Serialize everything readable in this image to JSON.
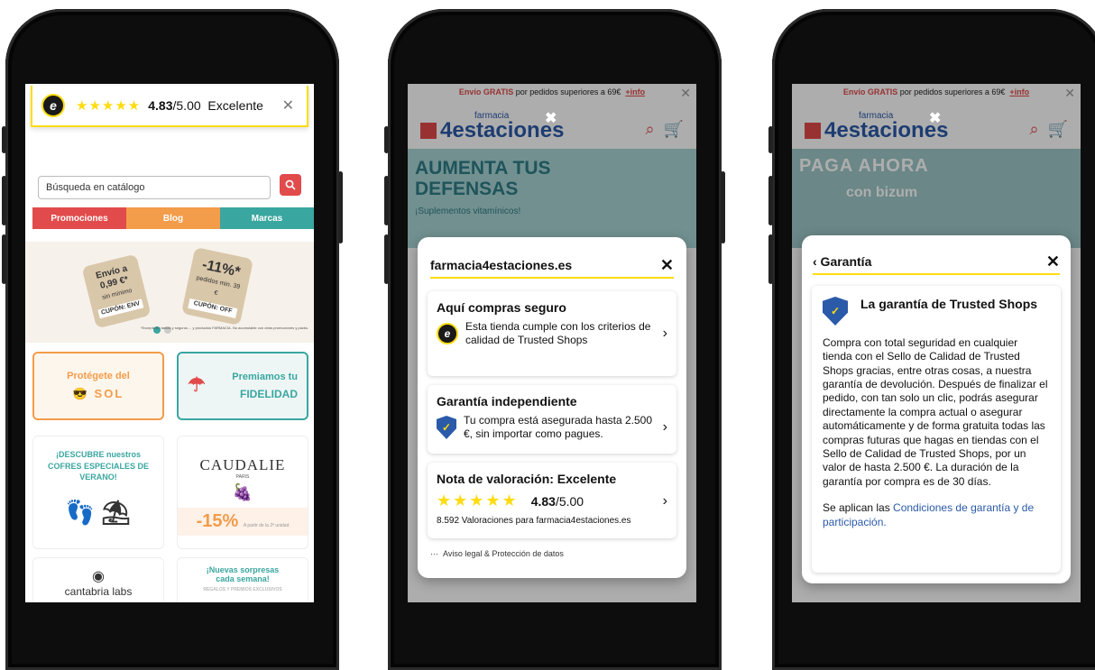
{
  "phone1": {
    "badge": {
      "stars": "★★★★★",
      "score": "4.83",
      "out_of": "/5.00",
      "label": "Excelente",
      "close": "✕",
      "logo": "e"
    },
    "search": {
      "placeholder": "Búsqueda en catálogo",
      "button_icon": "search-icon"
    },
    "tabs": [
      "Promociones",
      "Blog",
      "Marcas"
    ],
    "banner": {
      "tag1": "Envío a 0,99 €*",
      "tag1_sub": "sin mínimo",
      "tag1_coupon": "CUPÓN: ENV",
      "tag2": "-11%*",
      "tag2_sub": "pedidos min. 39 €",
      "tag2_coupon": "CUPÓN: OFF",
      "note": "*Excepto en tarifas y seguros ... y productos FARMACIA. No acumulable con otras promociones y packs."
    },
    "promo_sun": {
      "line1": "Protégete del",
      "line2": "SOL",
      "icon": "sun-glasses-icon"
    },
    "promo_loyal": {
      "line1": "Premiamos tu",
      "line2": "FIDELIDAD",
      "icon": "umbrella-icon"
    },
    "promo_box": {
      "text": "¡DESCUBRE nuestros COFRES ESPECIALES DE VERANO!"
    },
    "caudalie": {
      "brand": "CAUDALIE",
      "sub": "PARIS",
      "discount": "-15%",
      "discount_note": "A partir de la 2ª unidad"
    },
    "cantabria": {
      "brand": "cantabria labs"
    },
    "surprise": {
      "line1": "¡Nuevas sorpresas",
      "line2": "cada semana!",
      "line3": "REGALOS Y PREMIOS EXCLUSIVOS"
    }
  },
  "site": {
    "promo_bar": {
      "prefix": "Envío",
      "bold": "GRATIS",
      "text": "por pedidos superiores a 69€",
      "info": "+info",
      "close": "✕"
    },
    "logo": {
      "main": "4estaciones",
      "small": "farmacia"
    },
    "hero2": {
      "title_line1": "AUMENTA TUS",
      "title_line2": "DEFENSAS",
      "subtitle": "¡Suplementos vitamínicos!"
    },
    "hero3": {
      "title": "PAGA AHORA",
      "subtitle": "con bizum"
    },
    "overlay_close": "✖"
  },
  "phone2": {
    "domain": "farmacia4estaciones.es",
    "close": "✕",
    "card1": {
      "title": "Aquí compras seguro",
      "text": "Esta tienda cumple con los criterios de calidad de Trusted Shops"
    },
    "card2": {
      "title": "Garantía independiente",
      "text": "Tu compra está asegurada hasta 2.500 €, sin importar como pagues."
    },
    "card3": {
      "title": "Nota de valoración: Excelente",
      "stars": "★★★★★",
      "score": "4.83",
      "out_of": "/5.00",
      "reviews": "8.592 Valoraciones para farmacia4estaciones.es"
    },
    "legal": "Aviso legal & Protección de datos",
    "legal_dots": "···"
  },
  "phone3": {
    "back": "‹ Garantía",
    "close": "✕",
    "title": "La garantía de Trusted Shops",
    "body": "Compra con total seguridad en cualquier tienda con el Sello de Calidad de Trusted Shops gracias, entre otras cosas, a nuestra garantía de devolución. Después de finalizar el pedido, con tan solo un clic, podrás asegurar directamente la compra actual o asegurar automáticamente y de forma gratuita todas las compras futuras que hagas en tiendas con el Sello de Calidad de Trusted Shops, por un valor de hasta 2.500 €. La duración de la garantía por compra es de 30 días.",
    "footer_prefix": "Se aplican las ",
    "footer_link": "Condiciones de garantía y de participación."
  }
}
